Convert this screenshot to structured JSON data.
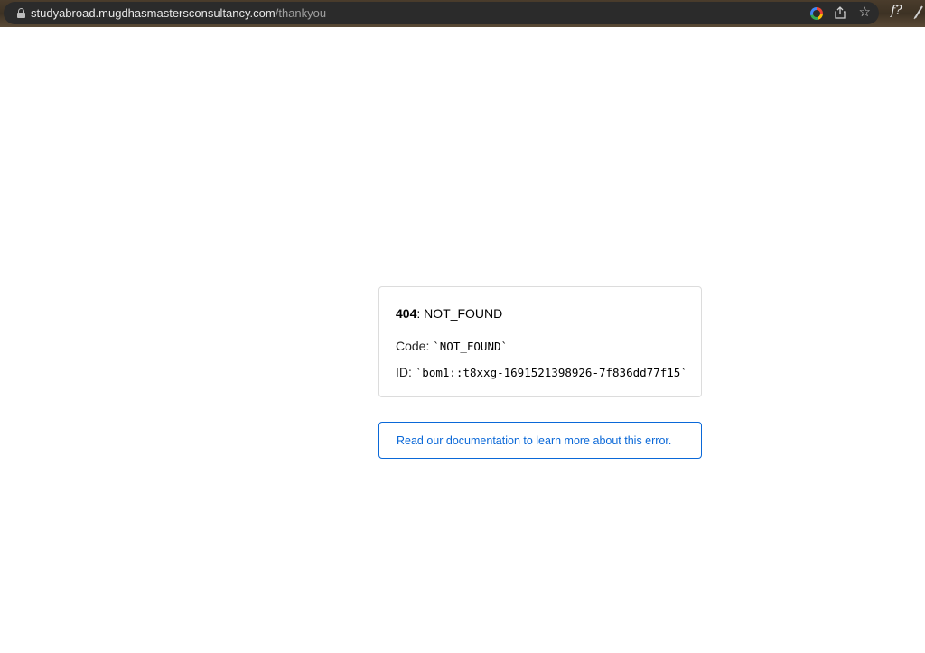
{
  "browser": {
    "url_host": "studyabroad.mugdhasmastersconsultancy.com",
    "url_path": "/thankyou",
    "extension_label": "f?",
    "icons": [
      "lock-icon",
      "google-icon",
      "share-icon",
      "star-icon",
      "extension-f-icon",
      "extension-pen-icon"
    ]
  },
  "error": {
    "status_code": "404",
    "status_text": ": NOT_FOUND",
    "code_label": "Code: ",
    "code_value": "`NOT_FOUND`",
    "id_label": "ID: ",
    "id_value": "`bom1::t8xxg-1691521398926-7f836dd77f15`"
  },
  "docs": {
    "link_text": "Read our documentation to learn more about this error."
  },
  "colors": {
    "link": "#0a68d8",
    "card_border": "#dcdcdc"
  }
}
